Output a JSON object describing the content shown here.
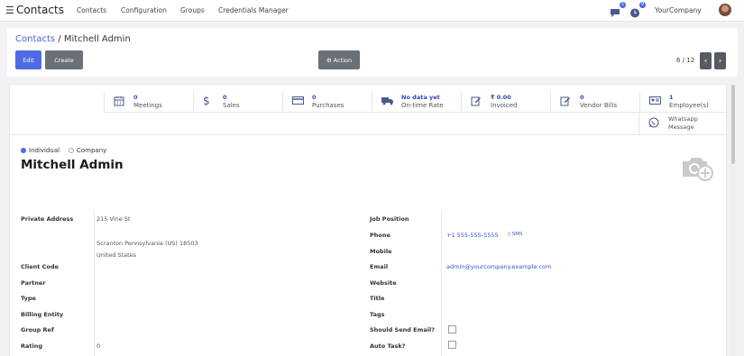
{
  "nav": {
    "app_title": "Contacts",
    "menu": [
      "Contacts",
      "Configuration",
      "Groups",
      "Credentials Manager"
    ],
    "chat_badge": "5",
    "activity_badge": "9",
    "company": "YourCompany"
  },
  "control": {
    "breadcrumb_parent": "Contacts",
    "breadcrumb_sep": " / ",
    "breadcrumb_current": "Mitchell Admin",
    "edit_label": "Edit",
    "create_label": "Create",
    "action_label": "⚙ Action",
    "pager": "6 / 12"
  },
  "stats": [
    {
      "icon": "calendar-icon",
      "value": "0",
      "label": "Meetings"
    },
    {
      "icon": "dollar-icon",
      "value": "0",
      "label": "Sales"
    },
    {
      "icon": "credit-card-icon",
      "value": "0",
      "label": "Purchases"
    },
    {
      "icon": "truck-icon",
      "value": "No data yet",
      "label": "On-time Rate"
    },
    {
      "icon": "edit-icon",
      "value": "₹ 0.00",
      "label": "Invoiced"
    },
    {
      "icon": "edit-icon",
      "value": "0",
      "label": "Vendor Bills"
    },
    {
      "icon": "id-card-icon",
      "value": "1",
      "label": "Employee(s)"
    }
  ],
  "whatsapp": {
    "line1": "Whatsapp",
    "line2": "Message"
  },
  "company_type": {
    "individual": "Individual",
    "company": "Company"
  },
  "partner_name": "Mitchell Admin",
  "left_fields": {
    "private_address_label": "Private Address",
    "street": "215 Vine St",
    "city_line": "Scranton  Pennsylvania (US)  18503",
    "country": "United States",
    "client_code_label": "Client Code",
    "partner_label": "Partner",
    "type_label": "Type",
    "billing_entity_label": "Billing Entity",
    "group_ref_label": "Group Ref",
    "rating_label": "Rating",
    "rating_value": "0"
  },
  "right_fields": {
    "job_position_label": "Job Position",
    "phone_label": "Phone",
    "phone_value": "+1 555-555-5555",
    "sms_label": "SMS",
    "mobile_label": "Mobile",
    "email_label": "Email",
    "email_value": "admin@yourcompany.example.com",
    "website_label": "Website",
    "title_label": "Title",
    "tags_label": "Tags",
    "send_email_label": "Should Send Email?",
    "auto_task_label": "Auto Task?"
  }
}
